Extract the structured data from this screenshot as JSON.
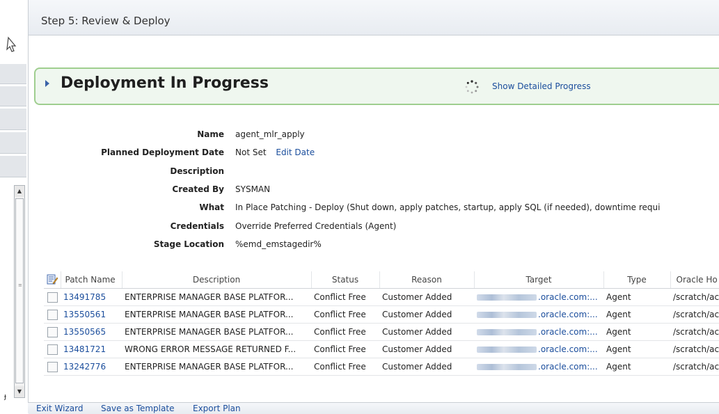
{
  "header": {
    "title": "Step 5: Review & Deploy"
  },
  "status": {
    "title": "Deployment In Progress",
    "detail_link": "Show Detailed Progress"
  },
  "properties": {
    "name_label": "Name",
    "name_value": "agent_mlr_apply",
    "date_label": "Planned Deployment Date",
    "date_value": "Not Set",
    "edit_date": "Edit Date",
    "description_label": "Description",
    "created_by_label": "Created By",
    "created_by_value": "SYSMAN",
    "what_label": "What",
    "what_value": "In Place Patching - Deploy (Shut down, apply patches, startup, apply SQL (if needed), downtime requi",
    "credentials_label": "Credentials",
    "credentials_value": "Override Preferred Credentials (Agent)",
    "stage_label": "Stage Location",
    "stage_value": "%emd_emstagedir%"
  },
  "table": {
    "columns": [
      "Patch Name",
      "Description",
      "Status",
      "Reason",
      "Target",
      "Type",
      "Oracle Ho"
    ],
    "rows": [
      {
        "patch": "13491785",
        "description": "ENTERPRISE MANAGER BASE PLATFOR...",
        "status": "Conflict Free",
        "reason": "Customer Added",
        "target": ".oracle.com:...",
        "type": "Agent",
        "home": "/scratch/ac"
      },
      {
        "patch": "13550561",
        "description": "ENTERPRISE MANAGER BASE PLATFOR...",
        "status": "Conflict Free",
        "reason": "Customer Added",
        "target": ".oracle.com:...",
        "type": "Agent",
        "home": "/scratch/ac"
      },
      {
        "patch": "13550565",
        "description": "ENTERPRISE MANAGER BASE PLATFOR...",
        "status": "Conflict Free",
        "reason": "Customer Added",
        "target": ".oracle.com:...",
        "type": "Agent",
        "home": "/scratch/ac"
      },
      {
        "patch": "13481721",
        "description": "WRONG ERROR MESSAGE RETURNED F...",
        "status": "Conflict Free",
        "reason": "Customer Added",
        "target": ".oracle.com:...",
        "type": "Agent",
        "home": "/scratch/ac"
      },
      {
        "patch": "13242776",
        "description": "ENTERPRISE MANAGER BASE PLATFOR...",
        "status": "Conflict Free",
        "reason": "Customer Added",
        "target": ".oracle.com:...",
        "type": "Agent",
        "home": "/scratch/ac"
      }
    ]
  },
  "footer": {
    "exit": "Exit Wizard",
    "save_template": "Save as Template",
    "export": "Export Plan"
  },
  "left_panel": {
    "glyph": "ɟ"
  },
  "icons": {
    "expand": "triangle-right-icon",
    "spinner": "loading-spinner-icon",
    "edit_columns": "edit-columns-icon",
    "cursor": "mouse-pointer-icon"
  },
  "colors": {
    "link": "#1a4d9c",
    "status_box_bg": "#eff7ef",
    "status_box_border": "#9fce8f",
    "header_bg": "#e8ecf1"
  }
}
